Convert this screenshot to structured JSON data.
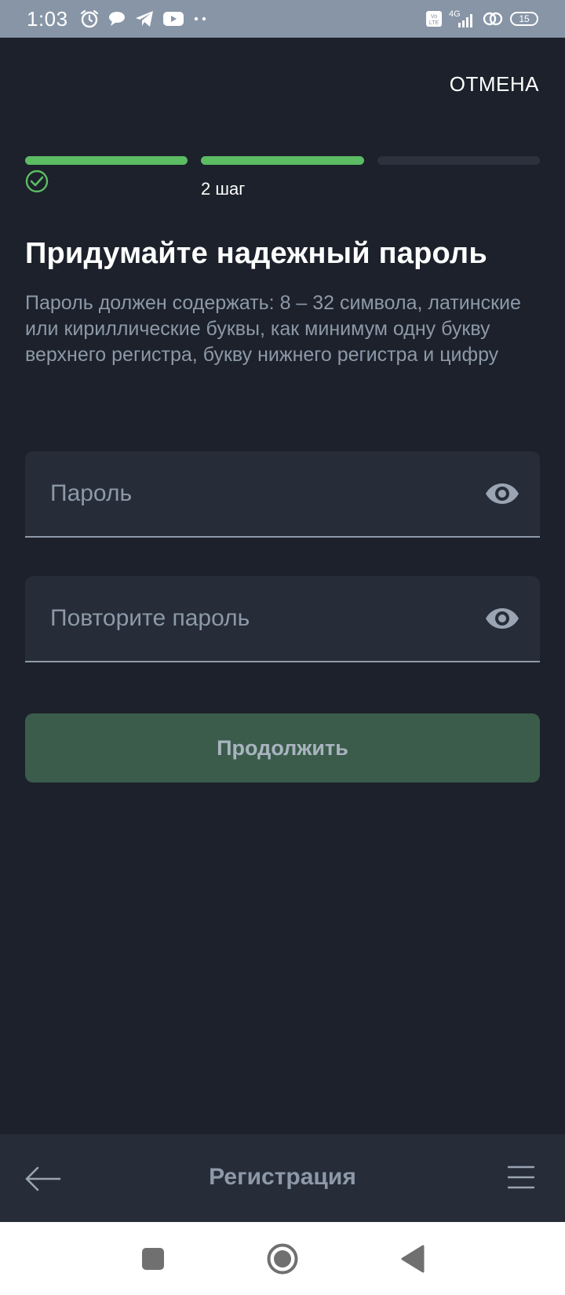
{
  "status_bar": {
    "time": "1:03",
    "icons": [
      "alarm-icon",
      "chat-bubble-icon",
      "telegram-icon",
      "youtube-icon",
      "more-dots-icon"
    ],
    "volte": "Vo LTE",
    "network": "4G",
    "battery": "15"
  },
  "header": {
    "cancel_label": "ОТМЕНА"
  },
  "steps": {
    "total": 3,
    "completed": 2,
    "current_label": "2 шаг",
    "accent_color": "#5cbc63"
  },
  "title": "Придумайте надежный пароль",
  "description": "Пароль должен содержать: 8 – 32 символа, латинские или кириллические буквы, как минимум одну букву верхнего регистра, букву нижнего регистра и цифру",
  "form": {
    "password_placeholder": "Пароль",
    "password_value": "",
    "repeat_placeholder": "Повторите пароль",
    "repeat_value": "",
    "continue_label": "Продолжить"
  },
  "bottom_nav": {
    "title": "Регистрация",
    "back_icon": "arrow-left-icon",
    "menu_icon": "menu-icon"
  },
  "system_nav": [
    "recent-apps-icon",
    "home-icon",
    "back-triangle-icon"
  ]
}
